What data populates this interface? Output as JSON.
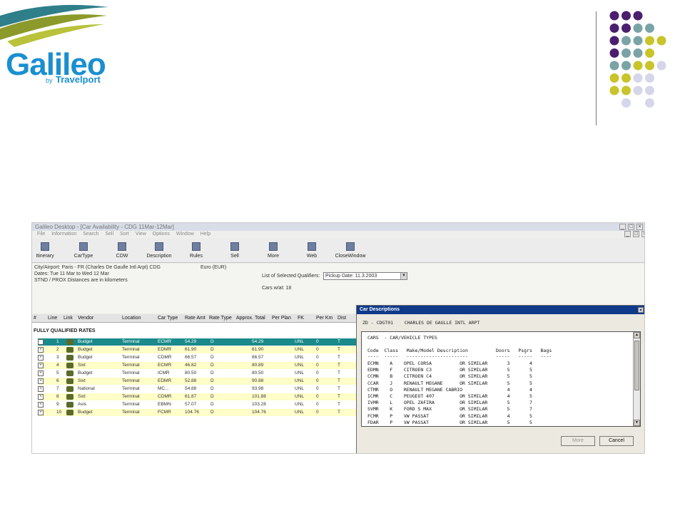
{
  "logo": {
    "word": "Galileo",
    "by": "by",
    "brand": "Travelport",
    "colors": {
      "blue": "#1a8fd0",
      "olive": "#8c9a2b",
      "teal": "#2e7f8a"
    }
  },
  "decor_dot_colors": {
    "purple": "#4b1f6e",
    "teal": "#7aa3a6",
    "yellow": "#c8c42a",
    "lavender": "#d6d6ea"
  },
  "window": {
    "title": "Galileo Desktop - [Car Availability - CDG 11Mar-12Mar]",
    "menu": [
      "File",
      "Information",
      "Search",
      "Sell",
      "Sort",
      "View",
      "Options",
      "Window",
      "Help"
    ],
    "toolbar": [
      "Itinerary",
      "CarType",
      "CDW",
      "Description",
      "Rules",
      "Sell",
      "More",
      "Web",
      "CloseWindow"
    ],
    "info": {
      "line1": "City/Airport: Paris - FR (Charles De Gaulle Intl Arpt)  CDG",
      "currency": "Euro (EUR)",
      "line2": "Dates: Tue 11 Mar to Wed 12 Mar",
      "line3": "STND / PROX  Distances are in kilometers",
      "qual_label": "List of Selected Qualifiers:",
      "qual_value": "Pickup Date: 11.3.2003",
      "cars_label": "Cars w/at: 18"
    },
    "columns": [
      "#",
      "Line",
      "Link",
      "Vendor",
      "Location",
      "Car Type",
      "Rate Amt",
      "Rate Type",
      "Approx. Total",
      "Per Plan",
      "FK",
      "Per Km",
      "Dist"
    ],
    "section_title": "FULLY QUALIFIED RATES",
    "rows": [
      {
        "line": "1",
        "vendor": "Budget",
        "location": "Terminal",
        "car_type": "ECMR",
        "rate": "54.29",
        "rate_type": "D",
        "total": "54.29",
        "plan": "UNL",
        "fk": "0",
        "dist": "T"
      },
      {
        "line": "2",
        "vendor": "Budget",
        "location": "Terminal",
        "car_type": "EDMR",
        "rate": "61.90",
        "rate_type": "D",
        "total": "61.90",
        "plan": "UNL",
        "fk": "0",
        "dist": "T"
      },
      {
        "line": "3",
        "vendor": "Budget",
        "location": "Terminal",
        "car_type": "CDMR",
        "rate": "66.57",
        "rate_type": "D",
        "total": "66.57",
        "plan": "UNL",
        "fk": "0",
        "dist": "T"
      },
      {
        "line": "4",
        "vendor": "Sixt",
        "location": "Terminal",
        "car_type": "ECMR",
        "rate": "46.82",
        "rate_type": "D",
        "total": "80.89",
        "plan": "UNL",
        "fk": "0",
        "dist": "T"
      },
      {
        "line": "5",
        "vendor": "Budget",
        "location": "Terminal",
        "car_type": "ICMR",
        "rate": "80.50",
        "rate_type": "D",
        "total": "80.50",
        "plan": "UNL",
        "fk": "0",
        "dist": "T"
      },
      {
        "line": "6",
        "vendor": "Sixt",
        "location": "Terminal",
        "car_type": "EDMR",
        "rate": "52.88",
        "rate_type": "D",
        "total": "90.88",
        "plan": "UNL",
        "fk": "0",
        "dist": "T"
      },
      {
        "line": "7",
        "vendor": "National",
        "location": "Terminal",
        "car_type": "MC...",
        "rate": "54.88",
        "rate_type": "D",
        "total": "93.98",
        "plan": "UNL",
        "fk": "0",
        "dist": "T"
      },
      {
        "line": "8",
        "vendor": "Sixt",
        "location": "Terminal",
        "car_type": "CDMR",
        "rate": "61.87",
        "rate_type": "D",
        "total": "101.88",
        "plan": "UNL",
        "fk": "0",
        "dist": "T"
      },
      {
        "line": "9",
        "vendor": "Avis",
        "location": "Terminal",
        "car_type": "EBMN",
        "rate": "57.07",
        "rate_type": "D",
        "total": "103.28",
        "plan": "UNL",
        "fk": "0",
        "dist": "T"
      },
      {
        "line": "10",
        "vendor": "Budget",
        "location": "Terminal",
        "car_type": "FCMR",
        "rate": "104.76",
        "rate_type": "D",
        "total": "104.76",
        "plan": "UNL",
        "fk": "0",
        "dist": "T"
      }
    ],
    "row_colors": {
      "selected": "#1a8a8a",
      "alt": "#fffdc8"
    }
  },
  "dialog": {
    "title": "Car Descriptions",
    "sub": "ZD - CDGT01    CHARLES DE GAULLE INTL ARPT",
    "heading": "CARS  - CAR/VEHICLE TYPES",
    "columns": "Code  Class   Make/Model Description          Doors   Psgrs   Bags",
    "underline": "----  -----   ----------------------          -----   -----   ----",
    "lines": [
      "ECMN    A    OPEL CORSA          OR SIMILAR       3       4",
      "EDMN    F    CITROEN C3          OR SIMILAR       5       5",
      "CCMN    B    CITROEN C4          OR SIMILAR       5       5",
      "CCAR    J    RENAULT MEGANE      OR SIMILAR       5       5",
      "CTMR    O    RENAULT MEGANE CABRIO                4       4",
      "ICMR    C    PEUGEOT 407         OR SIMILAR       4       5",
      "IVMR    L    OPEL ZAFIRA         OR SIMILAR       5       7",
      "SVMR    K    FORD S MAX          OR SIMILAR       5       7",
      "FCMR    P    VW PASSAT           OR SIMILAR       4       5",
      "FDAR    P    VW PASSAT           OR SIMILAR       5       5"
    ],
    "buttons": {
      "more": "More",
      "cancel": "Cancel"
    }
  }
}
